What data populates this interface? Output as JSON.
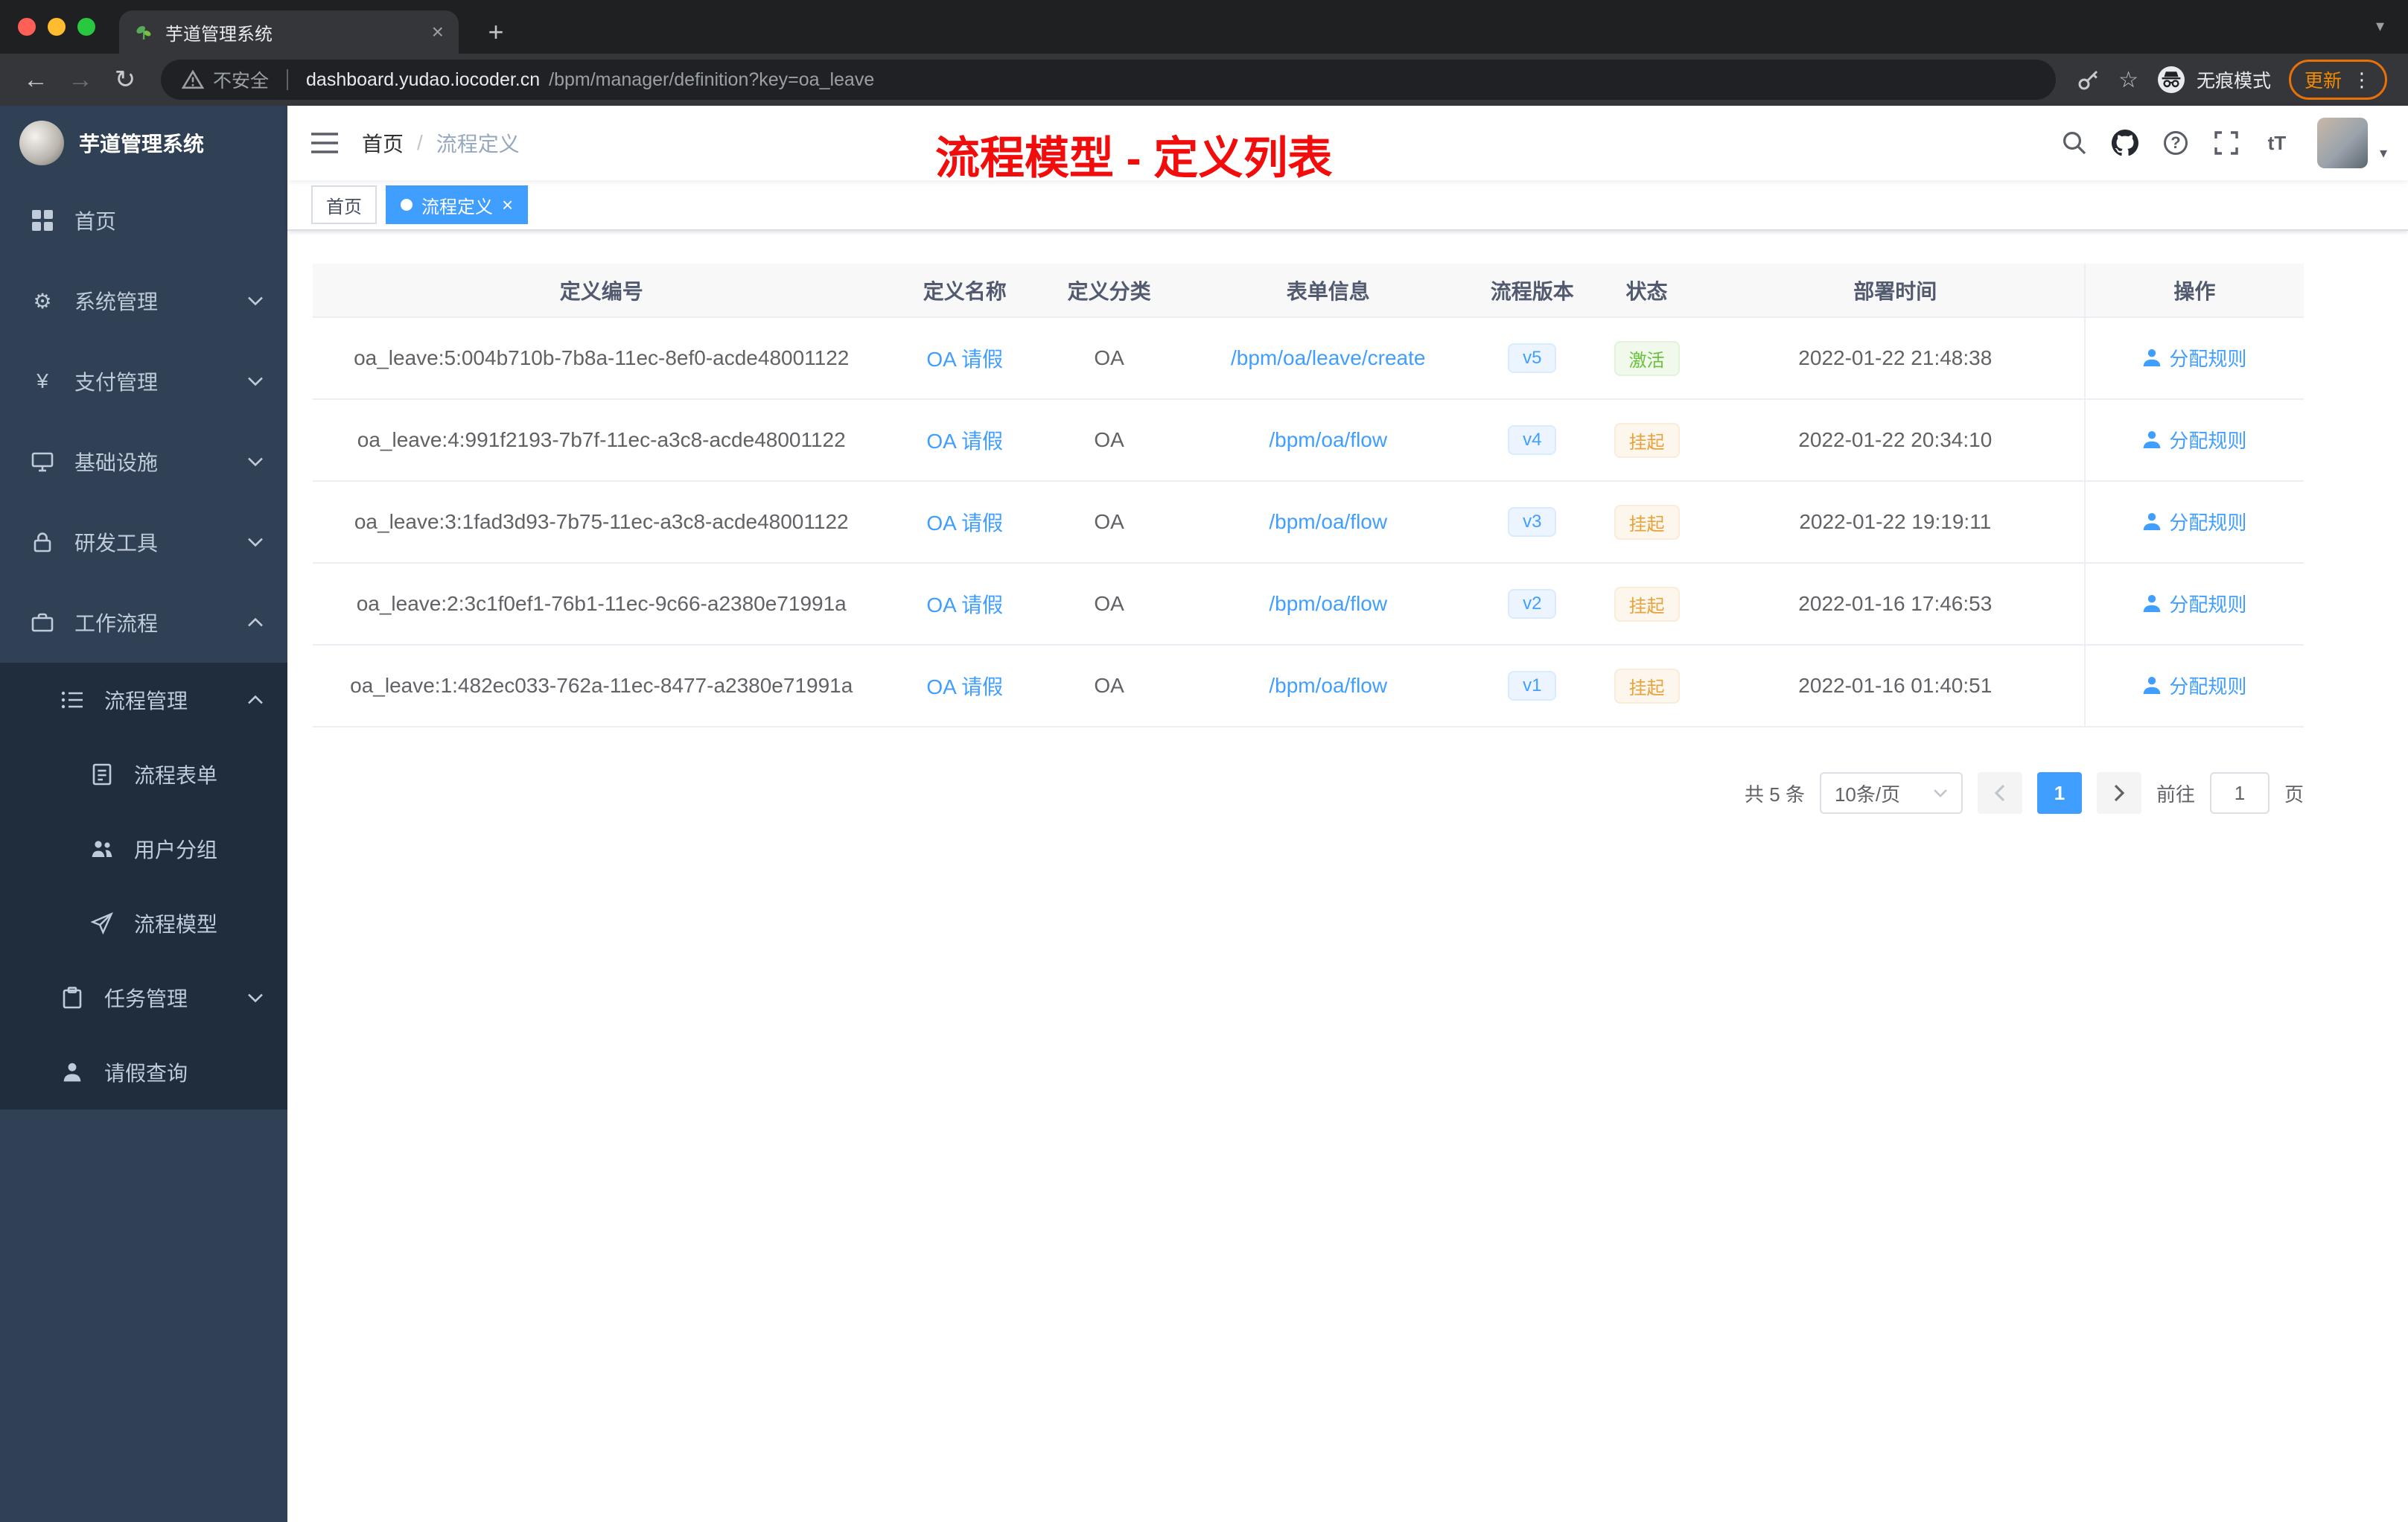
{
  "colors": {
    "accent": "#409eff",
    "success": "#67c23a",
    "warning": "#e6a23c",
    "annotation_red": "#f20d0d",
    "sidebar_bg": "#304156",
    "submenu_bg": "#1f2d3d"
  },
  "icons": {
    "close": "×",
    "plus": "+",
    "more": "⋮",
    "back": "←",
    "forward": "→",
    "reload": "↻",
    "star": "☆",
    "chevron_down": "▾",
    "caret": "▾",
    "question": "?",
    "text_size": "tT",
    "gear": "⚙",
    "yen": "¥"
  },
  "browser": {
    "tab_title": "芋道管理系统",
    "security_label": "不安全",
    "url_host": "dashboard.yudao.iocoder.cn",
    "url_path": "/bpm/manager/definition?key=oa_leave",
    "incognito_label": "无痕模式",
    "update_label": "更新"
  },
  "sidebar": {
    "app_title": "芋道管理系统",
    "items": [
      {
        "label": "首页"
      },
      {
        "label": "系统管理"
      },
      {
        "label": "支付管理"
      },
      {
        "label": "基础设施"
      },
      {
        "label": "研发工具"
      },
      {
        "label": "工作流程"
      },
      {
        "label": "流程管理"
      },
      {
        "label": "流程表单"
      },
      {
        "label": "用户分组"
      },
      {
        "label": "流程模型"
      },
      {
        "label": "任务管理"
      },
      {
        "label": "请假查询"
      }
    ]
  },
  "header": {
    "breadcrumb_home": "首页",
    "breadcrumb_sep": "/",
    "breadcrumb_current": "流程定义",
    "annotation": "流程模型 - 定义列表"
  },
  "tags": [
    {
      "label": "首页"
    },
    {
      "label": "流程定义"
    }
  ],
  "table": {
    "columns": [
      "定义编号",
      "定义名称",
      "定义分类",
      "表单信息",
      "流程版本",
      "状态",
      "部署时间",
      "操作"
    ],
    "rows": [
      {
        "id": "oa_leave:5:004b710b-7b8a-11ec-8ef0-acde48001122",
        "name": "OA 请假",
        "category": "OA",
        "form": "/bpm/oa/leave/create",
        "version": "v5",
        "status": "激活",
        "status_type": "success",
        "time": "2022-01-22 21:48:38",
        "action": "分配规则"
      },
      {
        "id": "oa_leave:4:991f2193-7b7f-11ec-a3c8-acde48001122",
        "name": "OA 请假",
        "category": "OA",
        "form": "/bpm/oa/flow",
        "version": "v4",
        "status": "挂起",
        "status_type": "warning",
        "time": "2022-01-22 20:34:10",
        "action": "分配规则"
      },
      {
        "id": "oa_leave:3:1fad3d93-7b75-11ec-a3c8-acde48001122",
        "name": "OA 请假",
        "category": "OA",
        "form": "/bpm/oa/flow",
        "version": "v3",
        "status": "挂起",
        "status_type": "warning",
        "time": "2022-01-22 19:19:11",
        "action": "分配规则"
      },
      {
        "id": "oa_leave:2:3c1f0ef1-76b1-11ec-9c66-a2380e71991a",
        "name": "OA 请假",
        "category": "OA",
        "form": "/bpm/oa/flow",
        "version": "v2",
        "status": "挂起",
        "status_type": "warning",
        "time": "2022-01-16 17:46:53",
        "action": "分配规则"
      },
      {
        "id": "oa_leave:1:482ec033-762a-11ec-8477-a2380e71991a",
        "name": "OA 请假",
        "category": "OA",
        "form": "/bpm/oa/flow",
        "version": "v1",
        "status": "挂起",
        "status_type": "warning",
        "time": "2022-01-16 01:40:51",
        "action": "分配规则"
      }
    ]
  },
  "pagination": {
    "total": "共 5 条",
    "page_size": "10条/页",
    "page": "1",
    "goto_label": "前往",
    "goto_value": "1",
    "unit_label": "页"
  }
}
